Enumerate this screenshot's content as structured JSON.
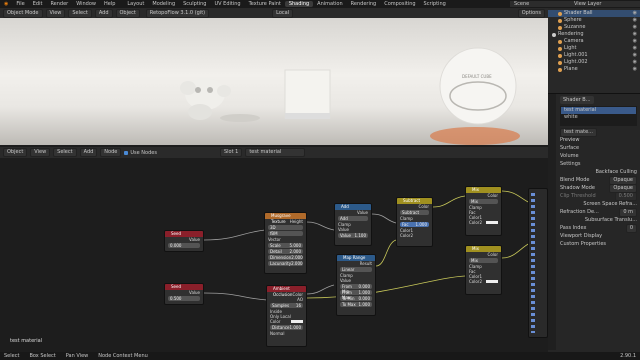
{
  "menubar": {
    "items": [
      "File",
      "Edit",
      "Render",
      "Window",
      "Help"
    ]
  },
  "workspaces": {
    "tabs": [
      "Layout",
      "Modeling",
      "Sculpting",
      "UV Editing",
      "Texture Paint",
      "Shading",
      "Animation",
      "Rendering",
      "Compositing",
      "Scripting"
    ],
    "active": "Shading"
  },
  "topright": {
    "scene": "Scene",
    "view_layer": "View Layer"
  },
  "viewport_header": {
    "mode": "Object Mode",
    "menus": [
      "View",
      "Select",
      "Add",
      "Object"
    ],
    "file": "RetopoFlow 3.1.0 (git)",
    "orientation": "Local",
    "options": "Options"
  },
  "viewport": {
    "sphere_label": "DEFAULT CUBE"
  },
  "node_header": {
    "type": "Object",
    "menus": [
      "View",
      "Select",
      "Add",
      "Node"
    ],
    "use_nodes": "Use Nodes",
    "slot": "Slot 1",
    "material": "test material"
  },
  "nodes": {
    "seed": {
      "title": "Seed",
      "value_label": "Value",
      "value": "0.000"
    },
    "seed2": {
      "title": "Seed",
      "value_label": "Value",
      "value": "0.500"
    },
    "musgrave": {
      "title": "Musgrave Texture",
      "height_label": "Height",
      "dim": "3D",
      "type": "fBM",
      "vector": "Vector",
      "rows": [
        "Scale",
        "Detail",
        "Dimension",
        "Lacunarity"
      ],
      "vals": [
        "5.000",
        "2.000",
        "2.000",
        "2.000"
      ]
    },
    "ao": {
      "title": "Ambient Occlusion",
      "color": "Color",
      "ao": "AO",
      "samples_label": "Samples",
      "samples": "16",
      "inside": "Inside",
      "only_local": "Only Local",
      "color_in": "Color",
      "distance_label": "Distance",
      "distance": "1.000",
      "normal": "Normal"
    },
    "add": {
      "title": "Add",
      "value_label": "Value",
      "op": "Add",
      "clamp": "Clamp",
      "val_label": "Value",
      "val": "1.100"
    },
    "maprange": {
      "title": "Map Range",
      "result": "Result",
      "interp": "Linear",
      "clamp": "Clamp",
      "value": "Value",
      "rows": [
        "From Min",
        "From Max",
        "To Min",
        "To Max"
      ],
      "vals": [
        "0.000",
        "1.000",
        "0.000",
        "1.000"
      ]
    },
    "subtract": {
      "title": "Subtract",
      "color": "Color",
      "op": "Subtract",
      "clamp": "Clamp",
      "fac": "Fac",
      "fac_val": "1.000",
      "c1": "Color1",
      "c2": "Color2"
    },
    "mix1": {
      "title": "Mix",
      "color": "Color",
      "op": "Mix",
      "clamp": "Clamp",
      "fac": "Fac",
      "c1": "Color1",
      "c2": "Color2"
    },
    "mix2": {
      "title": "Mix",
      "color": "Color",
      "op": "Mix",
      "clamp": "Clamp",
      "fac": "Fac",
      "c1": "Color1",
      "c2": "Color2"
    }
  },
  "node_footer": {
    "material": "test material"
  },
  "outliner": {
    "items": [
      {
        "label": "Shader Ball",
        "icon": "triangle-icon",
        "color": "#e0a050",
        "selected": true
      },
      {
        "label": "Sphere",
        "icon": "triangle-icon",
        "color": "#e0a050",
        "selected": false
      },
      {
        "label": "Suzanne",
        "icon": "triangle-icon",
        "color": "#e0a050",
        "selected": false
      },
      {
        "label": "Rendering",
        "icon": "collection-icon",
        "color": "#cccccc",
        "selected": false
      },
      {
        "label": "Camera",
        "icon": "camera-icon",
        "color": "#e0a050",
        "selected": false
      },
      {
        "label": "Light",
        "icon": "light-icon",
        "color": "#e0a050",
        "selected": false
      },
      {
        "label": "Light.001",
        "icon": "light-icon",
        "color": "#e0a050",
        "selected": false
      },
      {
        "label": "Light.002",
        "icon": "light-icon",
        "color": "#e0a050",
        "selected": false
      },
      {
        "label": "Plane",
        "icon": "triangle-icon",
        "color": "#e0a050",
        "selected": false
      }
    ]
  },
  "properties": {
    "object": "Shader B...",
    "slots": [
      "test material",
      "white"
    ],
    "material": "test mate...",
    "sections": [
      "Preview",
      "Surface",
      "Volume",
      "Settings"
    ],
    "backface": "Backface Culling",
    "blend_label": "Blend Mode",
    "blend": "Opaque",
    "shadow_label": "Shadow Mode",
    "shadow": "Opaque",
    "clip_label": "Clip Threshold",
    "clip": "0.500",
    "ssr": "Screen Space Refra...",
    "refr_label": "Refraction De...",
    "refr": "0 m",
    "sss": "Subsurface Translu...",
    "pass_label": "Pass Index",
    "pass": "0",
    "viewport_display": "Viewport Display",
    "custom": "Custom Properties"
  },
  "statusbar": {
    "select": "Select",
    "box": "Box Select",
    "pan": "Pan View",
    "ctx": "Node Context Menu",
    "version": "2.90.1"
  }
}
